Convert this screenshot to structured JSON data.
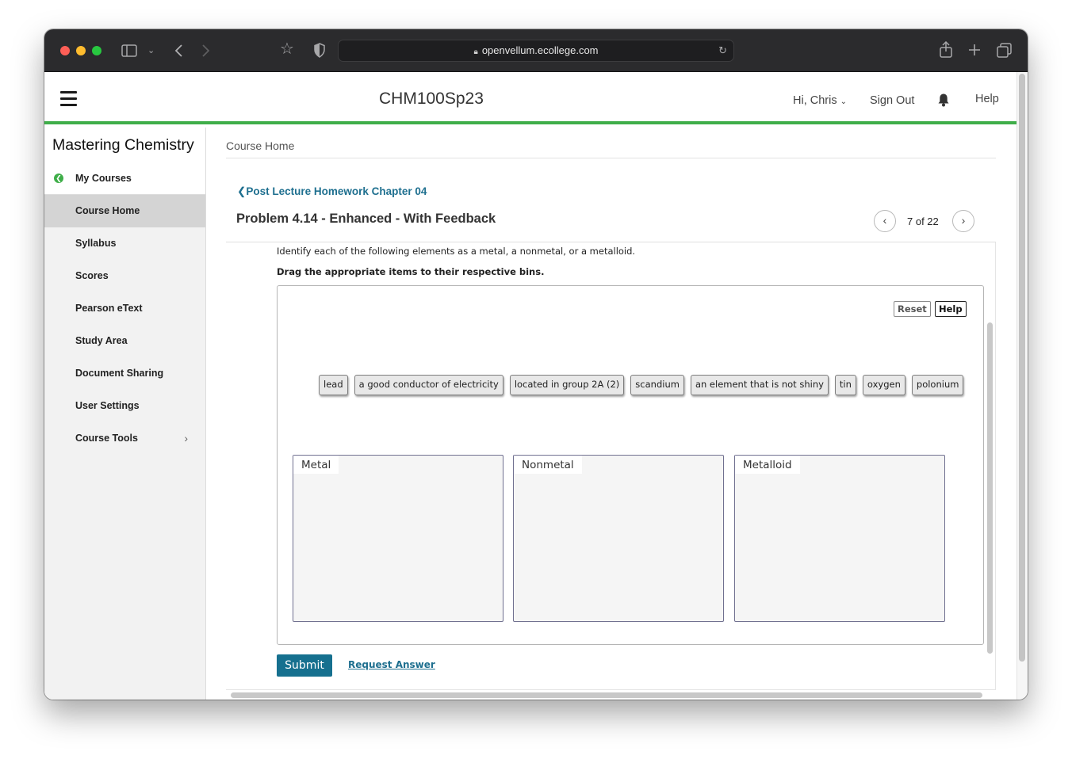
{
  "browser": {
    "url": "openvellum.ecollege.com",
    "icons": [
      "sidebar-icon",
      "chevron-down-icon",
      "back-icon",
      "forward-icon",
      "bookmark-star-icon",
      "shield-icon",
      "lock-icon",
      "reload-icon",
      "share-icon",
      "new-tab-icon",
      "tabs-overview-icon"
    ]
  },
  "header": {
    "course_title": "CHM100Sp23",
    "greeting": "Hi, Chris",
    "sign_out": "Sign Out",
    "help": "Help",
    "accent_color": "#3fae49"
  },
  "sidebar": {
    "brand": "Mastering Chemistry",
    "items": [
      {
        "label": "My Courses"
      },
      {
        "label": "Course Home"
      },
      {
        "label": "Syllabus"
      },
      {
        "label": "Scores"
      },
      {
        "label": "Pearson eText"
      },
      {
        "label": "Study Area"
      },
      {
        "label": "Document Sharing"
      },
      {
        "label": "User Settings"
      },
      {
        "label": "Course Tools"
      }
    ]
  },
  "main": {
    "breadcrumb": "Course Home",
    "back_link": "Post Lecture Homework Chapter 04",
    "problem_title": "Problem 4.14 - Enhanced - With Feedback",
    "pager": "7 of 22",
    "instruction": "Identify each of the following elements as a metal, a nonmetal, or a metalloid.",
    "instruction_bold": "Drag the appropriate items to their respective bins.",
    "reset": "Reset",
    "help": "Help",
    "items": [
      "lead",
      "a good conductor of electricity",
      "located in group 2A (2)",
      "scandium",
      "an element that is not shiny",
      "tin",
      "oxygen",
      "polonium"
    ],
    "bins": [
      "Metal",
      "Nonmetal",
      "Metalloid"
    ],
    "submit": "Submit",
    "request_answer": "Request Answer",
    "link_color": "#1e6f8f",
    "submit_color": "#16708f"
  }
}
